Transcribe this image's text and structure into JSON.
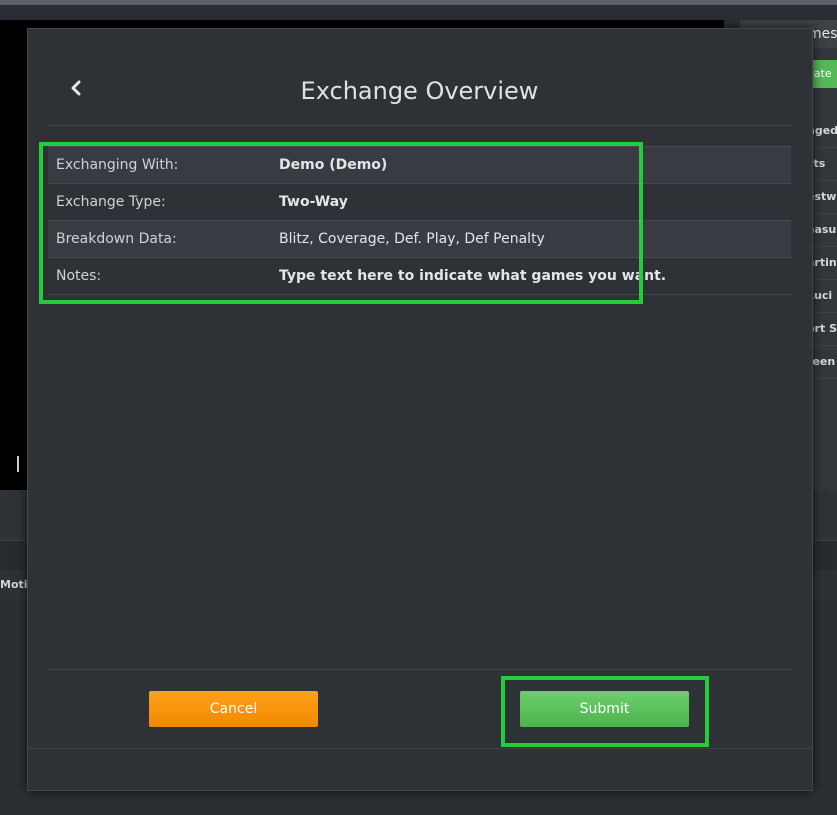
{
  "background": {
    "right_panel_title": "mes",
    "right_panel_button": "eate",
    "right_panel_items": [
      "nged",
      "sts",
      "estw",
      "easu",
      "artin",
      "Luci",
      "ort S",
      "reen"
    ],
    "motion_label": "Motio"
  },
  "modal": {
    "title": "Exchange Overview",
    "back_icon": "chevron-left-icon",
    "rows": [
      {
        "label": "Exchanging With:",
        "value": "Demo (Demo)"
      },
      {
        "label": "Exchange Type:",
        "value": "Two-Way"
      },
      {
        "label": "Breakdown Data:",
        "value": "Blitz, Coverage, Def. Play, Def Penalty"
      },
      {
        "label": "Notes:",
        "value": "Type text here to indicate what games you want."
      }
    ],
    "cancel_label": "Cancel",
    "submit_label": "Submit"
  },
  "colors": {
    "cancel": "#f7950c",
    "submit": "#5cc15c",
    "highlight": "#22cc3a"
  }
}
